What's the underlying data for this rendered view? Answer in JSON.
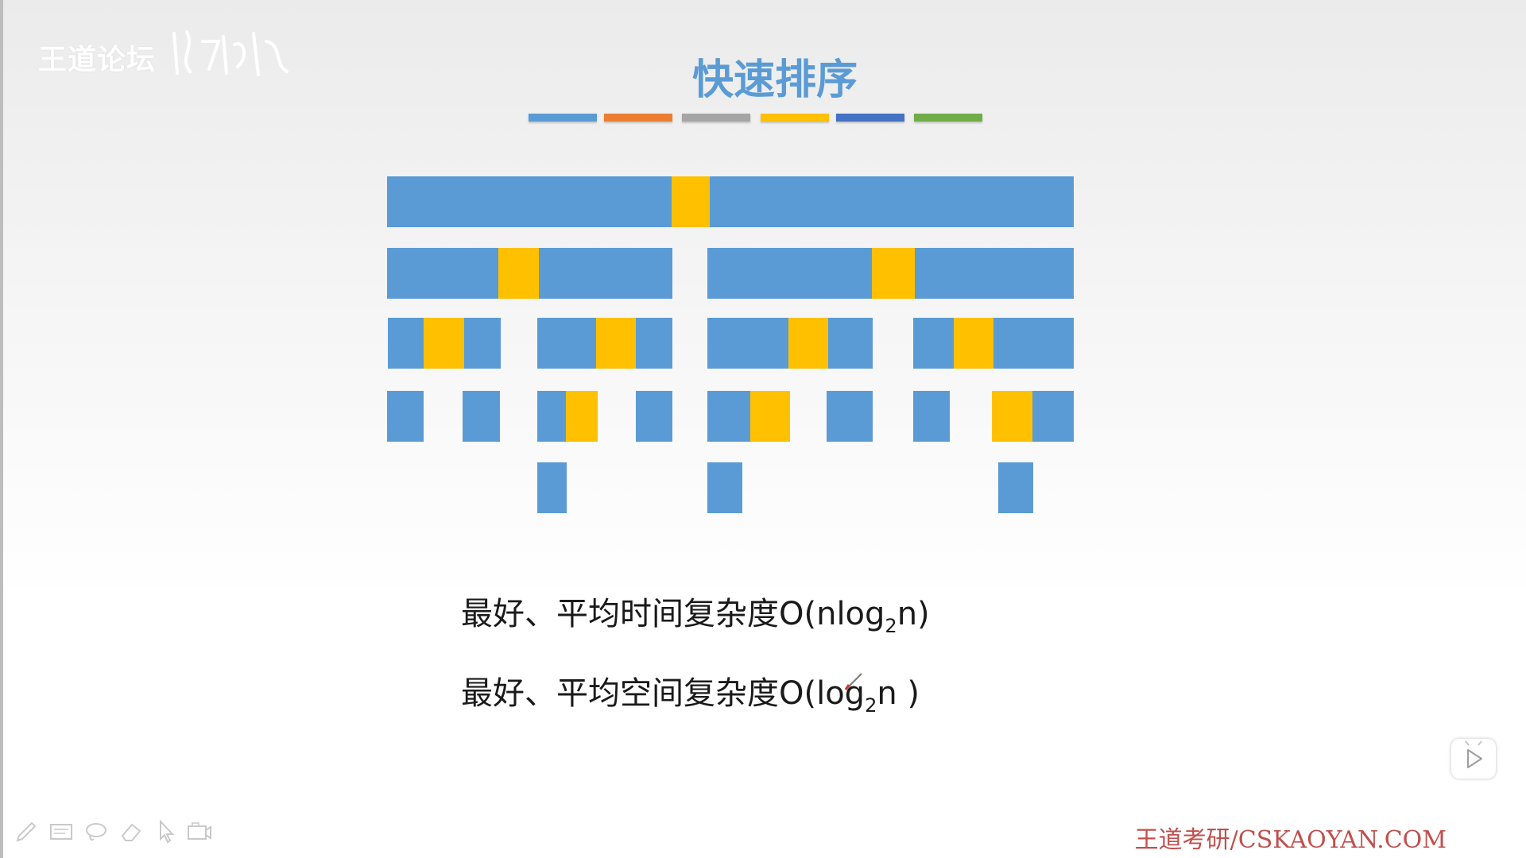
{
  "watermark": {
    "text": "王道论坛"
  },
  "slide": {
    "title": "快速排序",
    "accent_colors": [
      "#5b9bd5",
      "#ed7d31",
      "#a5a5a5",
      "#ffc000",
      "#4472c4",
      "#70ad47"
    ],
    "segment_color": "#5b9bd5",
    "pivot_color": "#ffc000",
    "formula_time": {
      "prefix": "最好、平均时间复杂度O(nlog",
      "sub": "2",
      "suffix": "n)"
    },
    "formula_space": {
      "prefix": "最好、平均空间复杂度O(log",
      "sub": "2",
      "suffix": "n )"
    }
  },
  "footer": {
    "url": "王道考研/CSKAOYAN.COM"
  },
  "toolbar": {
    "tools": [
      "pen-icon",
      "whiteboard-icon",
      "lasso-icon",
      "eraser-icon",
      "pointer-icon",
      "camera-icon"
    ]
  },
  "player": {
    "play_icon": "play-icon"
  }
}
